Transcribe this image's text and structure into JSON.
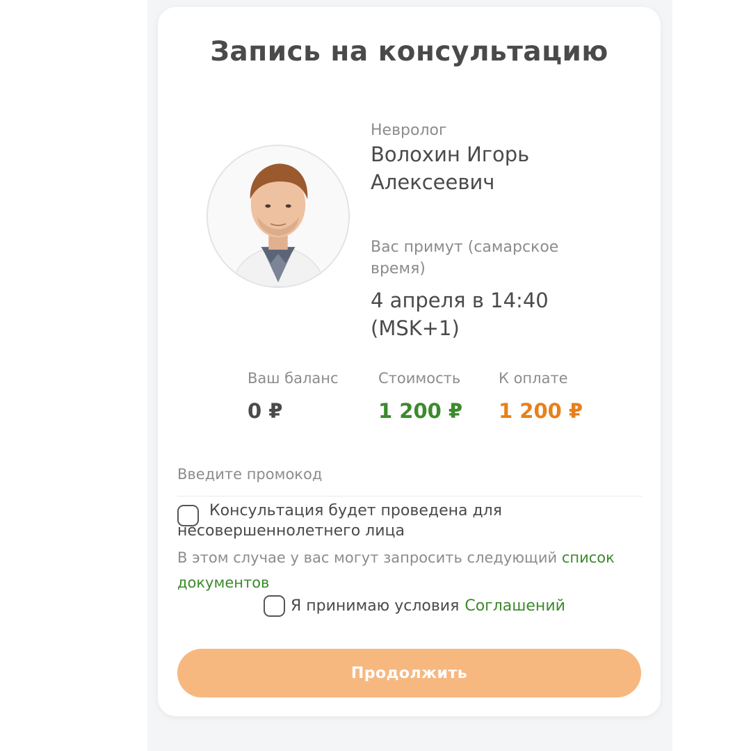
{
  "booking": {
    "title": "Запись на консультацию",
    "doctor": {
      "specialty": "Невролог",
      "name": "Волохин Игорь Алексеевич"
    },
    "appointment": {
      "label": "Вас примут (самарское время)",
      "datetime": "4 апреля в 14:40 (MSK+1)"
    },
    "prices": {
      "balance_label": "Ваш баланс",
      "balance_value": "0 ₽",
      "cost_label": "Стоимость",
      "cost_value": "1 200 ₽",
      "pay_label": "К оплате",
      "pay_value": "1 200 ₽"
    },
    "promo": {
      "placeholder": "Введите промокод",
      "value": ""
    },
    "minor": {
      "checkbox_label": "Консультация будет проведена для несовершеннолетнего лица",
      "checked": false,
      "note": "В этом случае у вас могут запросить следующий",
      "note_link": "список документов"
    },
    "agreement": {
      "text": "Я принимаю условия",
      "link": "Соглашений",
      "checked": false
    },
    "continue_label": "Продолжить"
  },
  "colors": {
    "cost": "#3b8a2c",
    "to_pay": "#e8801a",
    "balance": "#4a4a4a",
    "button": "#f7b880",
    "link": "#3b8a2c"
  },
  "icons": {
    "avatar": "doctor-photo"
  }
}
